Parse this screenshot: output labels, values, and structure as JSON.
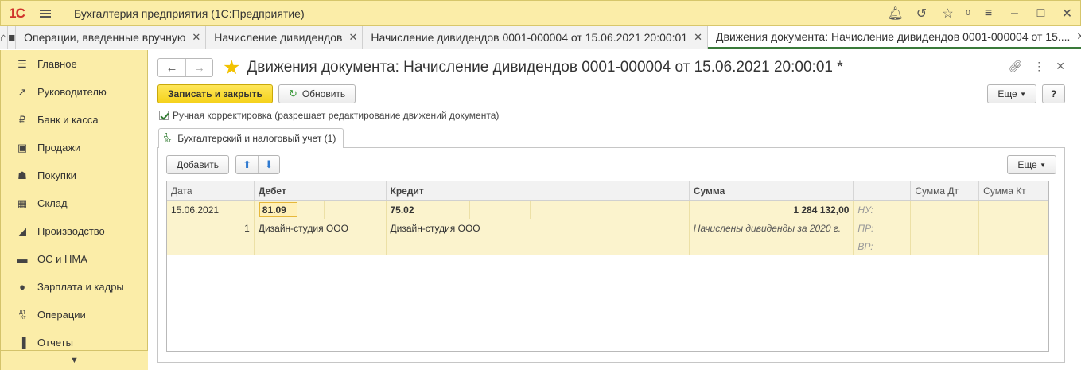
{
  "app": {
    "logo_text": "1С",
    "title": "Бухгалтерия предприятия  (1С:Предприятие)",
    "badge": "0"
  },
  "tabs": [
    {
      "label": "Операции, введенные вручную"
    },
    {
      "label": "Начисление дивидендов"
    },
    {
      "label": "Начисление дивидендов 0001-000004 от 15.06.2021 20:00:01"
    },
    {
      "label": "Движения документа: Начисление дивидендов 0001-000004 от 15...."
    }
  ],
  "sidebar": {
    "items": [
      {
        "label": "Главное",
        "icon": "menu-lines-icon"
      },
      {
        "label": "Руководителю",
        "icon": "trend-icon"
      },
      {
        "label": "Банк и касса",
        "icon": "ruble-coin-icon"
      },
      {
        "label": "Продажи",
        "icon": "shopping-bag-icon"
      },
      {
        "label": "Покупки",
        "icon": "cart-icon"
      },
      {
        "label": "Склад",
        "icon": "warehouse-icon"
      },
      {
        "label": "Производство",
        "icon": "factory-icon"
      },
      {
        "label": "ОС и НМА",
        "icon": "truck-icon"
      },
      {
        "label": "Зарплата и кадры",
        "icon": "person-icon"
      },
      {
        "label": "Операции",
        "icon": "dt-kt-icon"
      },
      {
        "label": "Отчеты",
        "icon": "bar-chart-icon"
      }
    ]
  },
  "form": {
    "title": "Движения документа: Начисление дивидендов 0001-000004 от 15.06.2021 20:00:01 *",
    "save_close": "Записать и закрыть",
    "refresh": "Обновить",
    "more": "Еще",
    "help": "?",
    "manual_check_label": "Ручная корректировка (разрешает редактирование движений документа)",
    "subtab_label": "Бухгалтерский и налоговый учет (1)",
    "add": "Добавить",
    "more_panel": "Еще"
  },
  "grid": {
    "headers": {
      "date": "Дата",
      "debit": "Дебет",
      "credit": "Кредит",
      "sum": "Сумма",
      "blank": "",
      "sum_dt": "Сумма Дт",
      "sum_kt": "Сумма Кт"
    },
    "row": {
      "date": "15.06.2021",
      "number": "1",
      "debit_account": "81.09",
      "debit_subconto": "Дизайн-студия ООО",
      "credit_account": "75.02",
      "credit_subconto": "Дизайн-студия ООО",
      "sum": "1 284 132,00",
      "content": "Начислены дивиденды за 2020 г.",
      "nu": "НУ:",
      "pr": "ПР:",
      "vr": "ВР:"
    }
  }
}
